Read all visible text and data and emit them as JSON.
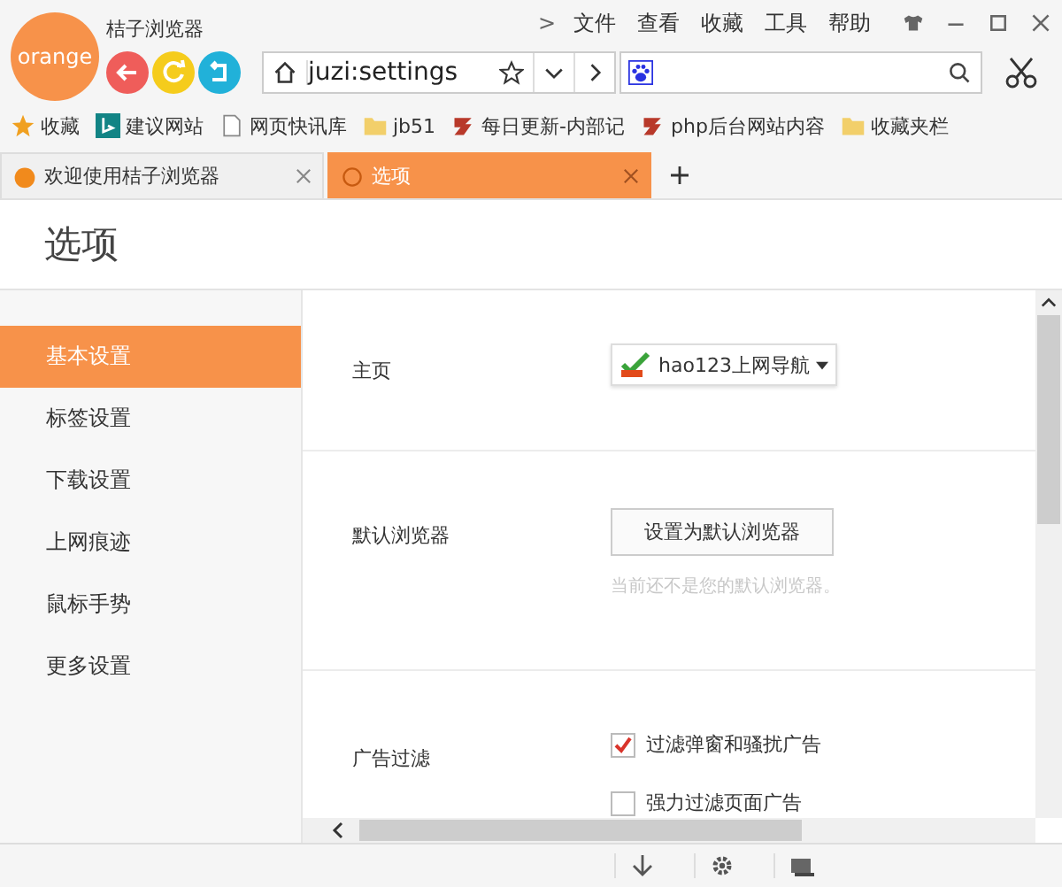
{
  "window": {
    "logo": "orange",
    "title": "桔子浏览器",
    "menu_arrow": ">",
    "menu": [
      "文件",
      "查看",
      "收藏",
      "工具",
      "帮助"
    ]
  },
  "address": {
    "value": "juzi:settings"
  },
  "bookmarks": [
    {
      "kind": "star",
      "label": "收藏"
    },
    {
      "kind": "bing",
      "label": "建议网站"
    },
    {
      "kind": "page",
      "label": "网页快讯库"
    },
    {
      "kind": "folder",
      "label": "jb51"
    },
    {
      "kind": "brand",
      "label": "每日更新-内部记"
    },
    {
      "kind": "brand",
      "label": "php后台网站内容"
    },
    {
      "kind": "folder",
      "label": "收藏夹栏"
    }
  ],
  "tabs": [
    {
      "label": "欢迎使用桔子浏览器",
      "selected": false
    },
    {
      "label": "选项",
      "selected": true
    }
  ],
  "page": {
    "title": "选项"
  },
  "sidebar": {
    "items": [
      {
        "label": "基本设置",
        "selected": true
      },
      {
        "label": "标签设置",
        "selected": false
      },
      {
        "label": "下载设置",
        "selected": false
      },
      {
        "label": "上网痕迹",
        "selected": false
      },
      {
        "label": "鼠标手势",
        "selected": false
      },
      {
        "label": "更多设置",
        "selected": false
      }
    ]
  },
  "sections": [
    {
      "label": "主页",
      "kind": "dropdown",
      "value": "hao123上网导航"
    },
    {
      "label": "默认浏览器",
      "kind": "button",
      "button": "设置为默认浏览器",
      "hint": "当前还不是您的默认浏览器。"
    },
    {
      "label": "广告过滤",
      "kind": "checkboxes",
      "options": [
        {
          "label": "过滤弹窗和骚扰广告",
          "checked": true
        },
        {
          "label": "强力过滤页面广告",
          "checked": false
        }
      ]
    }
  ]
}
